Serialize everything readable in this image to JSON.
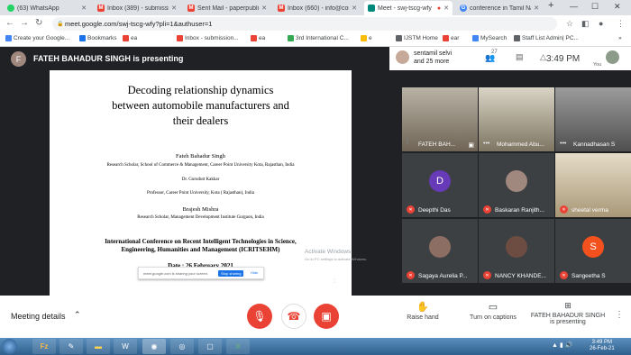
{
  "browser": {
    "tabs": [
      {
        "label": "(63) WhatsApp",
        "icon": "whatsapp-icon",
        "color": "#25d366"
      },
      {
        "label": "Inbox (389) - submission",
        "icon": "gmail-icon",
        "color": "#ea4335"
      },
      {
        "label": "Sent Mail - paperpublic",
        "icon": "gmail-icon",
        "color": "#ea4335"
      },
      {
        "label": "Inbox (660) - info@conf",
        "icon": "gmail-icon",
        "color": "#ea4335"
      },
      {
        "label": "Meet - swj-tscg-wfy",
        "icon": "meet-icon",
        "color": "#00897b"
      },
      {
        "label": "conference in Tamil Nad",
        "icon": "google-icon",
        "color": "#4285f4"
      }
    ],
    "new_tab": "+",
    "window_controls": {
      "minimize": "—",
      "maximize": "☐",
      "close": "✕"
    },
    "url": "meet.google.com/swj-tscg-wfy?pli=1&authuser=1",
    "bookmarks": [
      {
        "label": "Create your Google...",
        "color": "#4285f4"
      },
      {
        "label": "Bookmarks",
        "color": "#1a73e8"
      },
      {
        "label": "ea",
        "color": "#ea4335"
      },
      {
        "label": "Inbox - submission...",
        "color": "#ea4335"
      },
      {
        "label": "ea",
        "color": "#ea4335"
      },
      {
        "label": "3rd International C...",
        "color": "#34a853"
      },
      {
        "label": "e",
        "color": "#fbbc04"
      },
      {
        "label": "IJSTM Home",
        "color": "#5f6368"
      },
      {
        "label": "ear",
        "color": "#ea4335"
      },
      {
        "label": "MySearch",
        "color": "#4285f4"
      },
      {
        "label": "Staff List Admin| PC...",
        "color": "#5f6368"
      }
    ]
  },
  "meet": {
    "presenter_initial": "F",
    "presenting_label": "FATEH BAHADUR SINGH is presenting",
    "selected_participant": {
      "line1": "sentamil selvi",
      "line2": "and 25 more"
    },
    "people_count": "27",
    "clock": "3:49 PM",
    "you_label": "You",
    "participants": [
      {
        "name": "FATEH BAH...",
        "initial": "",
        "video": true,
        "color": "#8a7866"
      },
      {
        "name": "Mohammed Abu...",
        "initial": "",
        "video": true,
        "color": "#9e9580"
      },
      {
        "name": "Kannadhasan S",
        "initial": "",
        "video": true,
        "color": "#7b7b7b"
      },
      {
        "name": "Deepthi Das",
        "initial": "D",
        "video": false,
        "color": "#673ab7"
      },
      {
        "name": "Baskaran Ranjith...",
        "initial": "",
        "video": false,
        "color": "#a1887f"
      },
      {
        "name": "sheetal verma",
        "initial": "",
        "video": true,
        "color": "#c2b59b"
      },
      {
        "name": "Sagaya Aurelia P...",
        "initial": "",
        "video": false,
        "color": "#8d6e63"
      },
      {
        "name": "NANCY KHANDE...",
        "initial": "",
        "video": false,
        "color": "#6d4c41"
      },
      {
        "name": "Sangeetha S",
        "initial": "S",
        "video": false,
        "color": "#f4511e"
      }
    ],
    "bottom": {
      "meeting_details": "Meeting details",
      "raise_hand": "Raise hand",
      "captions": "Turn on captions",
      "presenting_line1": "FATEH BAHADUR SINGH",
      "presenting_line2": "is presenting"
    }
  },
  "slide": {
    "title_line1": "Decoding relationship dynamics",
    "title_line2": "between automobile manufacturers and",
    "title_line3": "their dealers",
    "author1": "Fateh Bahadur Singh",
    "author1_affil": "Research Scholar, School of Commerce & Management, Career Point University Kota, Rajasthan, India",
    "author2": "Dr. Gurudutt Kakkar",
    "author2_affil": "Professor, Career Point University, Kota ( Rajasthan), India",
    "author3": "Brajesh Mishra",
    "author3_affil": "Research Scholar, Management Development Institute Gurgaon, India",
    "conf_line1": "International Conference on Recent Intelligent Technologies in Science,",
    "conf_line2": "Engineering, Humanities and Management (ICRITSEHM)",
    "date": "Date : 26 February 2021"
  },
  "share_bar": {
    "text": "meet.google.com is sharing your screen.",
    "stop": "Stop sharing",
    "hide": "Hide"
  },
  "watermark": {
    "line1": "Activate Windows",
    "line2": "Go to PC settings to activate Windows."
  },
  "taskbar": {
    "time": "3:49 PM",
    "date": "26-Feb-21"
  }
}
